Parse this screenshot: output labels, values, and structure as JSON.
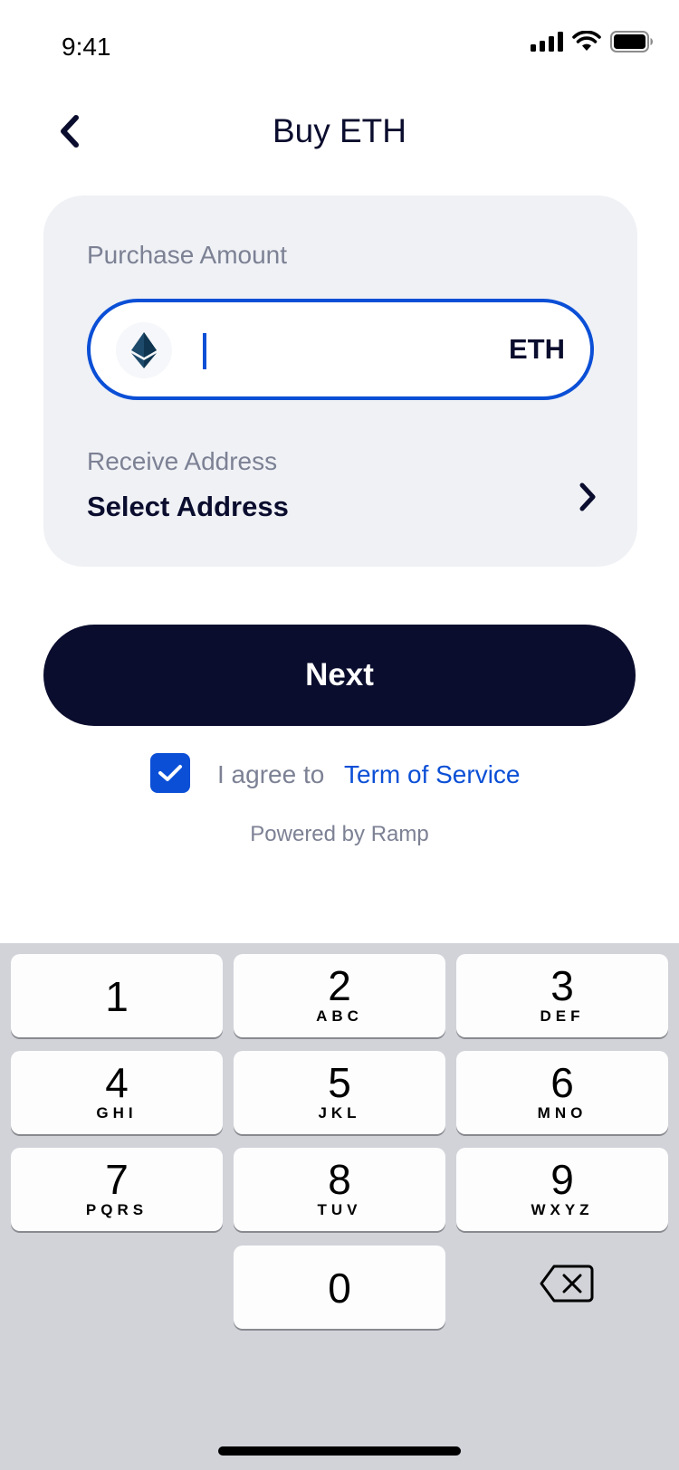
{
  "status_bar": {
    "time": "9:41",
    "icons": [
      "signal-icon",
      "wifi-icon",
      "battery-icon"
    ]
  },
  "header": {
    "back_icon": "chevron-left-icon",
    "title": "Buy ETH"
  },
  "card": {
    "purchase_label": "Purchase Amount",
    "amount_field": {
      "icon": "ethereum-icon",
      "value": "",
      "unit": "ETH"
    },
    "receive_label": "Receive Address",
    "select_address": "Select Address",
    "chevron_icon": "chevron-right-icon"
  },
  "next_button": "Next",
  "agreement": {
    "checked": true,
    "text": "I agree to",
    "link": "Term of Service"
  },
  "powered_by": "Powered by Ramp",
  "keypad": {
    "keys": [
      {
        "num": "1",
        "letters": ""
      },
      {
        "num": "2",
        "letters": "ABC"
      },
      {
        "num": "3",
        "letters": "DEF"
      },
      {
        "num": "4",
        "letters": "GHI"
      },
      {
        "num": "5",
        "letters": "JKL"
      },
      {
        "num": "6",
        "letters": "MNO"
      },
      {
        "num": "7",
        "letters": "PQRS"
      },
      {
        "num": "8",
        "letters": "TUV"
      },
      {
        "num": "9",
        "letters": "WXYZ"
      },
      {
        "num": "0",
        "letters": ""
      }
    ],
    "delete_icon": "backspace-icon"
  },
  "colors": {
    "primary": "#0b0d2e",
    "accent": "#0b4fd6",
    "card_bg": "#eff1f5",
    "muted_text": "#7c8194",
    "keyboard_bg": "#d1d3d9"
  }
}
